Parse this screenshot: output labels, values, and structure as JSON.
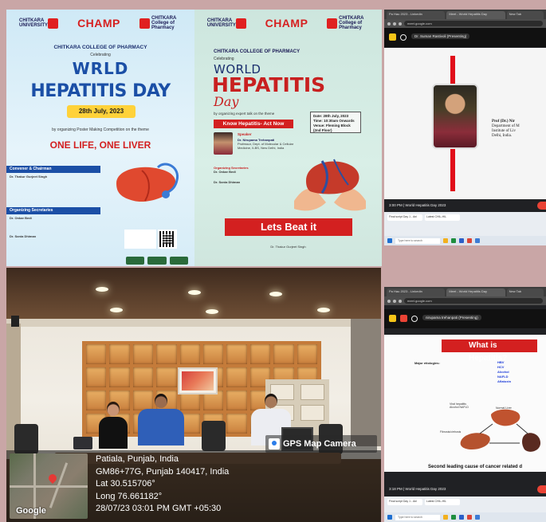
{
  "poster1": {
    "logo_left": "CHITKARA UNIVERSITY",
    "logo_mid": "CHAMP",
    "logo_right": "CHITKARA College of Pharmacy",
    "college": "CHITKARA COLLEGE OF PHARMACY",
    "celebrating": "Celebrating",
    "world": "WRLD",
    "hepatitis_day": "HEPATITIS DAY",
    "date": "28th July, 2023",
    "organizing": "by organizing Poster Making Competition on the theme",
    "theme": "ONE LIFE, ONE LIVER",
    "convener_head": "Convener & Chairman",
    "convener_name": "Dr. Thakur Gurjeet Singh",
    "org_head": "Organizing Secretaries",
    "sec1": "Dr. Onkar Bedi",
    "sec2": "Dr. Sonia Dhiman"
  },
  "poster2": {
    "logo_left": "CHITKARA UNIVERSITY",
    "logo_mid": "CHAMP",
    "logo_right": "CHITKARA College of Pharmacy",
    "college": "CHITKARA COLLEGE OF PHARMACY",
    "celebrating": "Celebrating",
    "world": "WORLD",
    "hepatitis": "HEPATITIS",
    "day": "Day",
    "organizing": "by organizing expert talk on the theme",
    "theme": "Know Hepatitis- Act Now",
    "info_date": "Date: 28th July, 2023",
    "info_time": "Time: 10:30am Onwards",
    "info_venue": "Venue: Fleming Block (2nd Floor)",
    "speaker_head": "Speaker",
    "speaker_name": "Dr. Nirupama Trehanpati",
    "speaker_desc": "Professor, Dept. of Molecular & Cellular Medicine, ILBS, New Delhi, India",
    "coord_head": "Organizing Secretaries",
    "coord1": "Dr. Onkar Bedi",
    "coord2": "Dr. Sonia Dhiman",
    "beat": "Lets Beat it",
    "chief": "Dr. Thakur Gurjeet Singh"
  },
  "screen1": {
    "tabs": [
      "Pa Hau 2023 - Linkedin",
      "Meet - World Hepatitis Day",
      "New Tab"
    ],
    "url": "meet.google.com",
    "presenter": "Dr. Suman Rastivoli (Presenting)",
    "prof": "Prof (Dr.) Nir",
    "prof_dept": "Department of M",
    "prof_inst": "Institute of Liv",
    "prof_city": "Delhi, India.",
    "meet_time": "3:00 PM | World Hepatitis Day 2023",
    "bottom_tabs": [
      "Final script Day 1 - Ani",
      "Latest CHIL-HIL"
    ],
    "search": "Type here to search"
  },
  "screen2": {
    "tabs": [
      "Pa Hau 2023 - Linkedin",
      "Meet - World Hepatitis Day",
      "New Tab"
    ],
    "url": "meet.google.com",
    "presenter": "nirupama trehanpati (Presenting)",
    "slide_title": "What is Hepatitis?",
    "major": "Major etiologies:",
    "viruses": [
      "HBV",
      "HCV",
      "Alcohol",
      "NAFLD",
      "Aflatoxin"
    ],
    "leg1": "Viral hepatitis Alcohol NAFLD",
    "leg2": "Normal Liver",
    "leg3": "Fibrosis/cirrhosis",
    "footer": "Second leading cause of cancer related d",
    "meet_time": "3:18 PM | World Hepatitis Day 2023",
    "bottom_tabs": [
      "Final script Day 1 - Ani",
      "Latest CHIL-HIL"
    ],
    "search": "Type here to search"
  },
  "gps": {
    "title": "GPS Map Camera",
    "location": "Patiala, Punjab, India",
    "address": "GM86+77G, Punjab 140417, India",
    "lat": "Lat 30.515706°",
    "long": "Long 76.661182°",
    "datetime": "28/07/23 03:01 PM GMT +05:30",
    "map_label": "Google"
  },
  "colors": {
    "red": "#d32020",
    "blue": "#1b4fa6",
    "meet_dark": "#202124",
    "background": "#c9a6a6"
  }
}
